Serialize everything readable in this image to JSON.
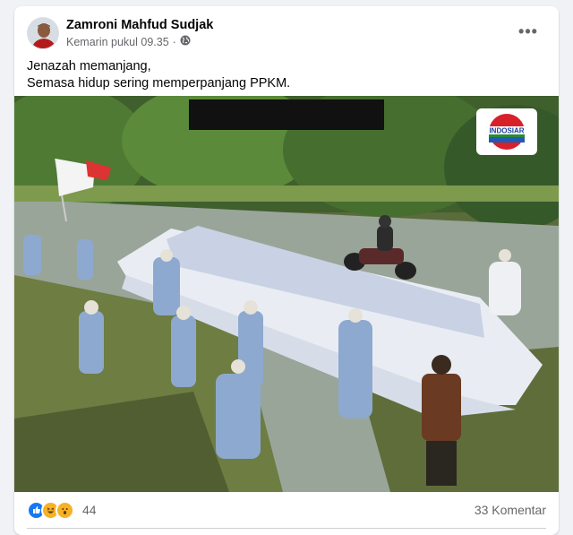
{
  "post": {
    "author": "Zamroni Mahfud Sudjak",
    "timestamp": "Kemarin pukul 09.35",
    "separator": "·",
    "privacy_icon": "globe-icon",
    "more_icon": "more-options-icon",
    "text_lines": [
      "Jenazah memanjang,",
      "Semasa hidup sering memperpanjang PPKM."
    ]
  },
  "image": {
    "watermark_logo": "INDOSIAR"
  },
  "footer": {
    "reactions": [
      "like-icon",
      "haha-icon",
      "wow-icon"
    ],
    "reaction_count": "44",
    "comments_label": "33 Komentar"
  },
  "colors": {
    "like": "#1877f2",
    "haha": "#f7b125",
    "text_primary": "#050505",
    "text_secondary": "#65676b"
  }
}
